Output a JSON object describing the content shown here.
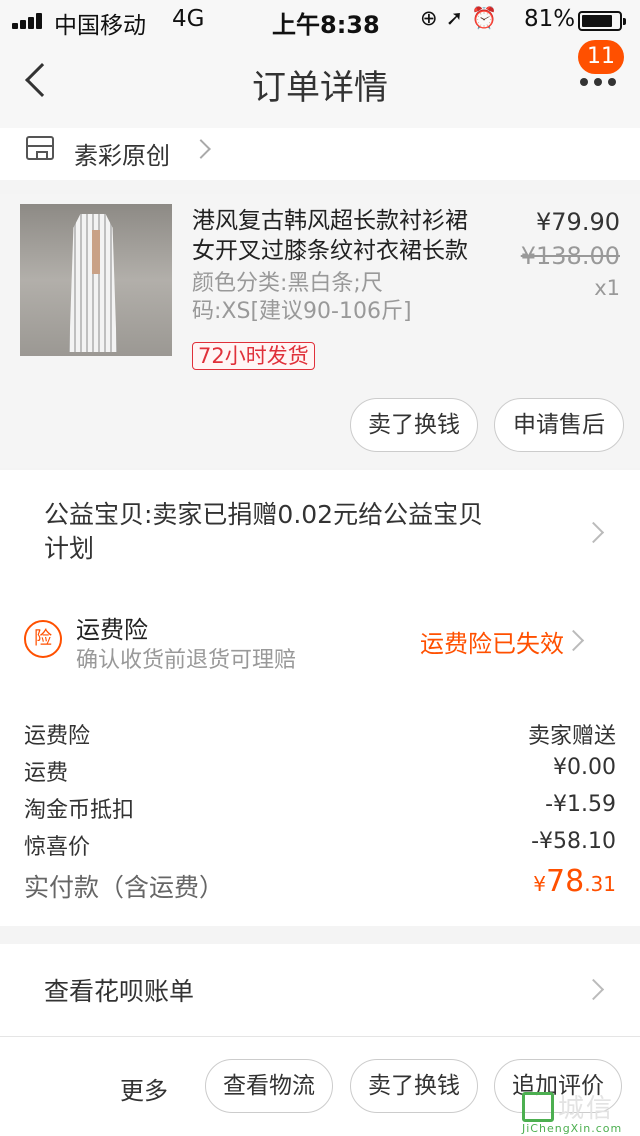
{
  "status_bar": {
    "carrier": "中国移动",
    "network": "4G",
    "time": "上午8:38",
    "battery": "81%"
  },
  "nav": {
    "title": "订单详情",
    "badge_count": "11"
  },
  "shop": {
    "name": "素彩原创"
  },
  "product": {
    "title_line1": "港风复古韩风超长款衬衫裙",
    "title_line2": "女开叉过膝条纹衬衣裙长款",
    "sku_line1": "颜色分类:黑白条;尺",
    "sku_line2": "码:XS[建议90-106斤]",
    "tag": "72小时发货",
    "price": "¥79.90",
    "original_price": "¥138.00",
    "quantity": "x1",
    "btn_sell": "卖了换钱",
    "btn_after_sale": "申请售后"
  },
  "charity": {
    "line1": "公益宝贝:卖家已捐赠0.02元给公益宝贝",
    "line2": "计划"
  },
  "insurance": {
    "icon_text": "险",
    "title": "运费险",
    "subtitle": "确认收货前退货可理赔",
    "status": "运费险已失效"
  },
  "fees": {
    "rows": [
      {
        "label": "运费险",
        "value": "卖家赠送"
      },
      {
        "label": "运费",
        "value": "¥0.00"
      },
      {
        "label": "淘金币抵扣",
        "value": "-¥1.59"
      },
      {
        "label": "惊喜价",
        "value": "-¥58.10"
      }
    ],
    "total_label": "实付款（含运费）",
    "total_currency": "¥",
    "total_int": "78",
    "total_dec": ".31"
  },
  "huabei": {
    "label": "查看花呗账单"
  },
  "bottom": {
    "more": "更多",
    "btn_logistics": "查看物流",
    "btn_sell": "卖了换钱",
    "btn_review": "追加评价"
  },
  "watermark": {
    "main": "城信",
    "sub": "JiChengXin.com"
  },
  "colors": {
    "accent": "#ff5000",
    "tag_red": "#e0303a",
    "watermark_green": "#4caf50"
  }
}
